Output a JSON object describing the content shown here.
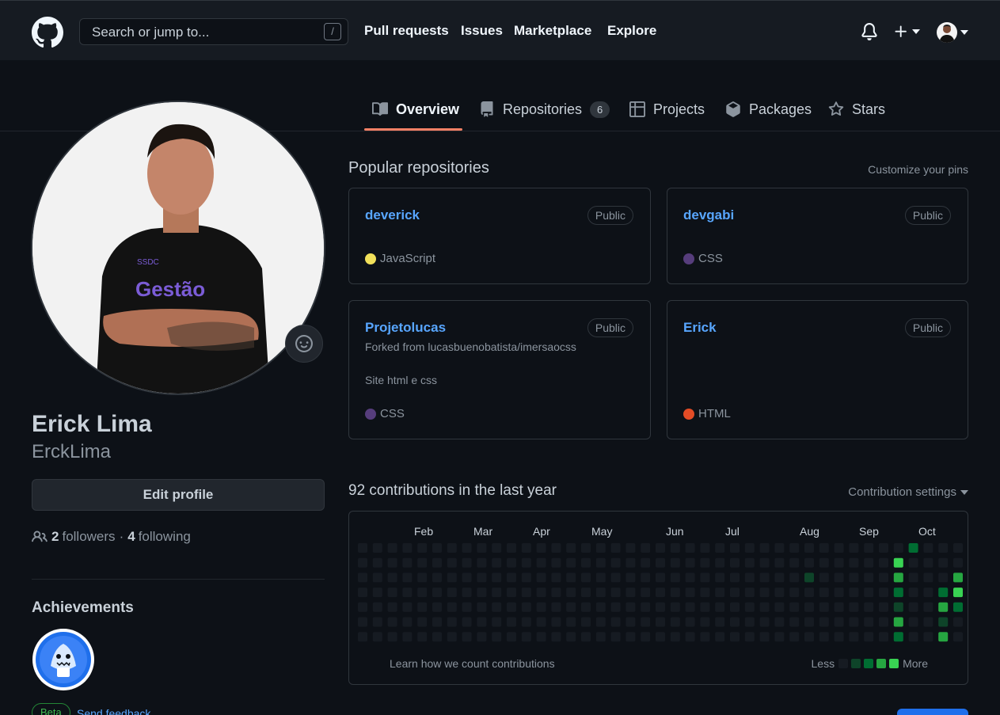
{
  "header": {
    "search_placeholder": "Search or jump to...",
    "search_shortcut": "/",
    "nav": [
      "Pull requests",
      "Issues",
      "Marketplace",
      "Explore"
    ]
  },
  "tabs": [
    {
      "label": "Overview",
      "icon": "book-icon",
      "active": true
    },
    {
      "label": "Repositories",
      "icon": "repo-icon",
      "count": "6"
    },
    {
      "label": "Projects",
      "icon": "table-icon"
    },
    {
      "label": "Packages",
      "icon": "package-icon"
    },
    {
      "label": "Stars",
      "icon": "star-icon"
    }
  ],
  "profile": {
    "name": "Erick Lima",
    "login": "ErckLima",
    "edit_label": "Edit profile",
    "followers_count": "2",
    "followers_label": "followers",
    "separator": "·",
    "following_count": "4",
    "following_label": "following",
    "achievements_title": "Achievements",
    "beta_label": "Beta",
    "feedback_label": "Send feedback"
  },
  "pinned": {
    "title": "Popular repositories",
    "customize": "Customize your pins",
    "repos": [
      {
        "name": "deverick",
        "visibility": "Public",
        "language": "JavaScript",
        "lang_color": "#f1e05a"
      },
      {
        "name": "devgabi",
        "visibility": "Public",
        "language": "CSS",
        "lang_color": "#563d7c"
      },
      {
        "name": "Projetolucas",
        "visibility": "Public",
        "forked": "Forked from lucasbuenobatista/imersaocss",
        "description": "Site html e css",
        "language": "CSS",
        "lang_color": "#563d7c"
      },
      {
        "name": "Erick",
        "visibility": "Public",
        "language": "HTML",
        "lang_color": "#e34c26"
      }
    ]
  },
  "contributions": {
    "title": "92 contributions in the last year",
    "settings": "Contribution settings",
    "months": [
      "Feb",
      "Mar",
      "Apr",
      "May",
      "Jun",
      "Jul",
      "Aug",
      "Sep",
      "Oct"
    ],
    "learn": "Learn how we count contributions",
    "less": "Less",
    "more": "More",
    "colors": [
      "#161b22",
      "#0e4429",
      "#006d32",
      "#26a641",
      "#39d353"
    ]
  }
}
